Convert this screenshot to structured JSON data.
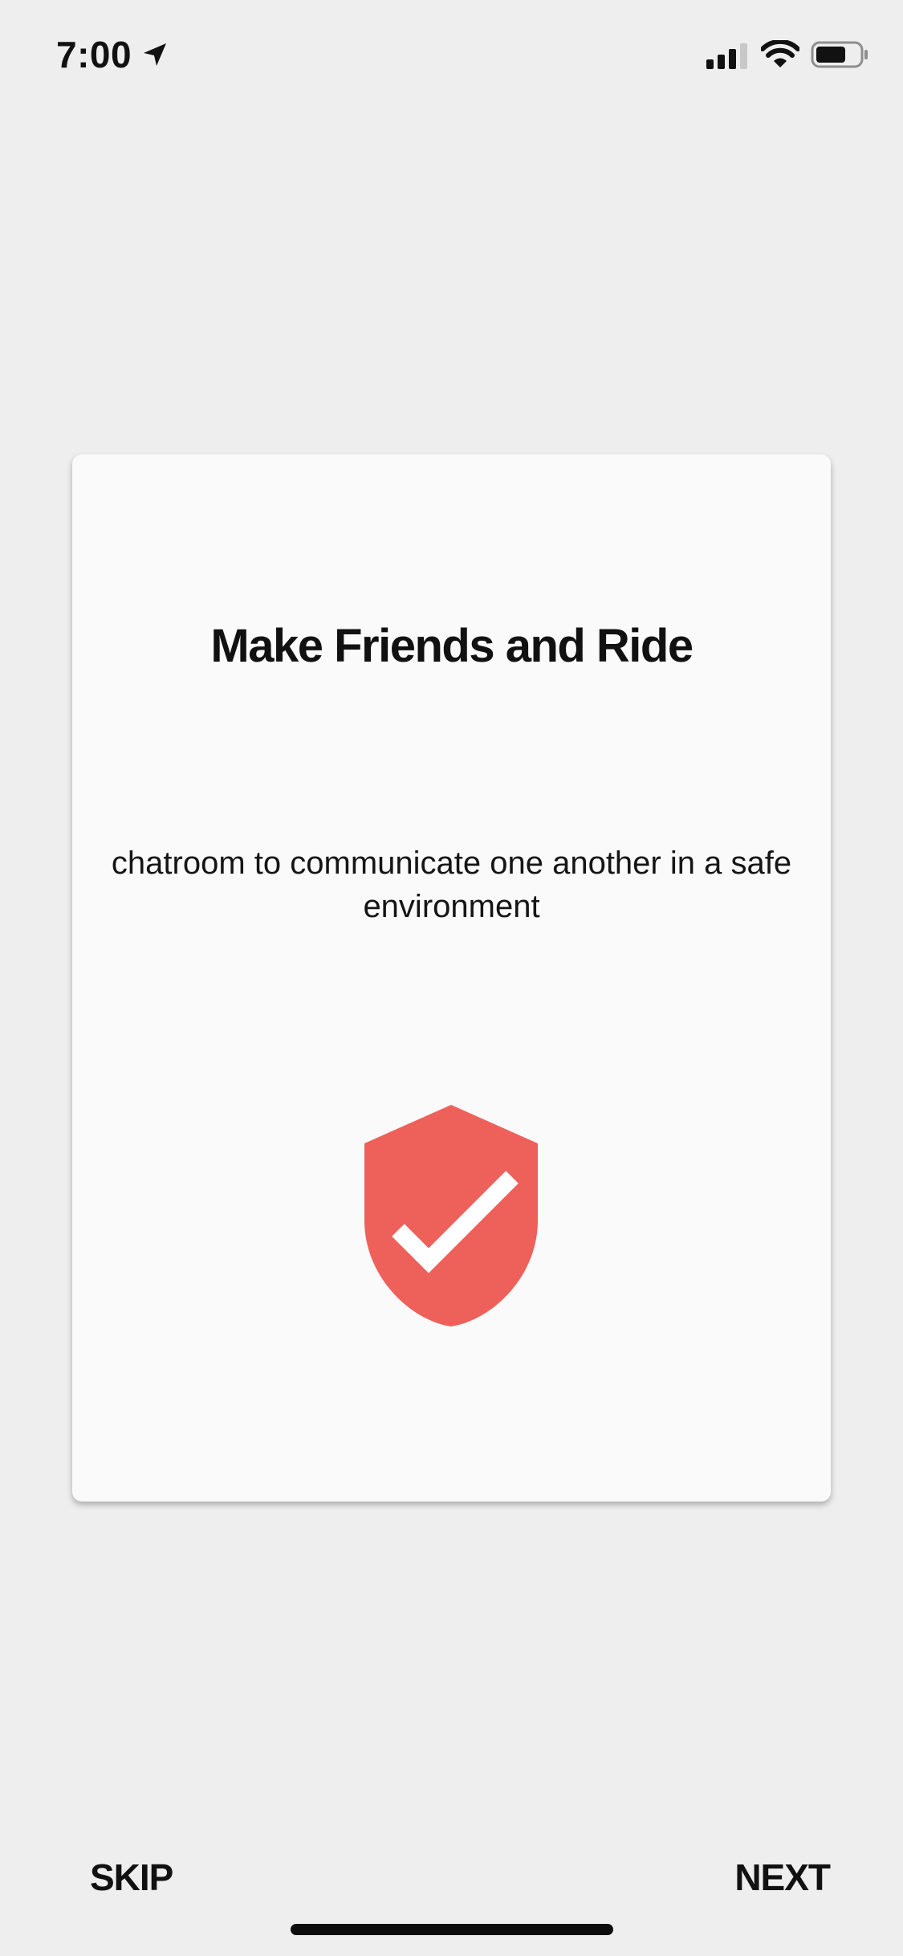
{
  "status_bar": {
    "time": "7:00",
    "icons": [
      "location-arrow-icon",
      "cellular-signal-icon",
      "wifi-icon",
      "battery-icon"
    ]
  },
  "onboarding": {
    "title": "Make Friends and Ride",
    "description": "chatroom to communicate one another in a safe environment",
    "icon": "shield-check-icon",
    "icon_color": "#ee605a"
  },
  "footer": {
    "skip_label": "SKIP",
    "next_label": "NEXT"
  },
  "colors": {
    "background": "#eeeeee",
    "card": "#fafafa",
    "text": "#111111",
    "accent": "#ee605a"
  }
}
